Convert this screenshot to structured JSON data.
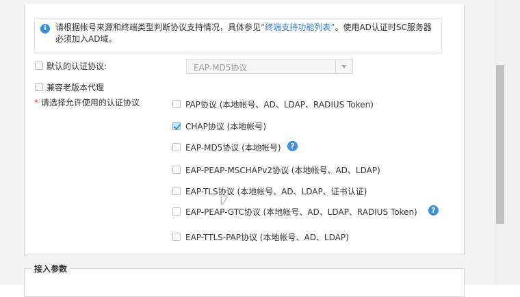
{
  "notice": {
    "text_before": "请根据帐号来源和终端类型判断协议支持情况，具体参见",
    "link": "“终端支持功能列表”",
    "text_after": "。使用AD认证时SC服务器必须加入AD域。"
  },
  "default_protocol": {
    "label": "默认的认证协议:",
    "checked": false,
    "select_value": "EAP-MD5协议"
  },
  "compat_proxy": {
    "label": "兼容老版本代理",
    "checked": false
  },
  "allowed": {
    "required_mark": "*",
    "label": "请选择允许使用的认证协议",
    "protocols": [
      {
        "label": "PAP协议 (本地帐号、AD、LDAP、RADIUS Token)",
        "checked": false,
        "help": false
      },
      {
        "label": "CHAP协议 (本地帐号)",
        "checked": true,
        "help": false
      },
      {
        "label": "EAP-MD5协议 (本地帐号)",
        "checked": false,
        "help": true
      },
      {
        "label": "EAP-PEAP-MSCHAPv2协议 (本地帐号、AD、LDAP)",
        "checked": false,
        "help": false
      },
      {
        "label": "EAP-TLS协议 (本地帐号、AD、LDAP、证书认证)",
        "checked": false,
        "help": false
      },
      {
        "label": "EAP-PEAP-GTC协议 (本地帐号、AD、LDAP、RADIUS Token)",
        "checked": false,
        "help": true
      },
      {
        "label": "EAP-TTLS-PAP协议 (本地帐号、AD、LDAP)",
        "checked": false,
        "help": false
      }
    ]
  },
  "access_params": {
    "title": "接入参数"
  },
  "icons": {
    "info": "info-icon",
    "help": "help-icon",
    "dropdown": "chevron-down-icon"
  },
  "colors": {
    "accent": "#3d8ee0",
    "link": "#2d7fd3",
    "required": "#ee3333"
  }
}
